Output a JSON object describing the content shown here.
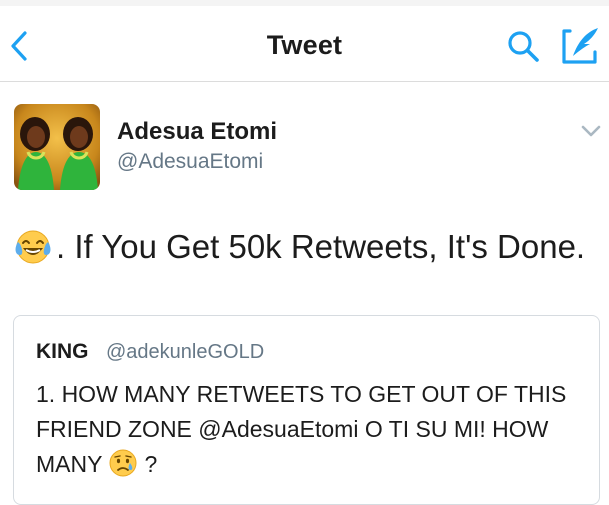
{
  "nav": {
    "title": "Tweet",
    "icons": [
      "back-chevron-icon",
      "search-icon",
      "compose-icon"
    ]
  },
  "tweet": {
    "author_name": "Adesua Etomi",
    "author_handle": "@AdesuaEtomi",
    "text": ". If You Get 50k Retweets, It's Done.",
    "emoji": "crying-laughing-emoji"
  },
  "quoted_tweet": {
    "author_name": "KING",
    "author_handle": "@adekunleGOLD",
    "text_before_emoji": "1. HOW MANY RETWEETS TO GET OUT OF THIS FRIEND ZONE @AdesuaEtomi O TI SU MI! HOW MANY",
    "text_after_emoji": "?",
    "emoji": "sad-relieved-face-emoji"
  },
  "colors": {
    "accent": "#1da1f2",
    "text": "#1c1c1c",
    "secondary_text": "#657786",
    "border": "#d6dbe0"
  }
}
